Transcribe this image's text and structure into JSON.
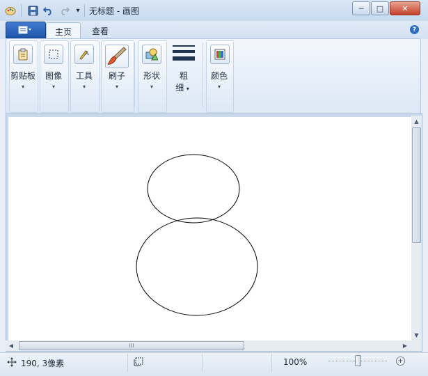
{
  "window": {
    "title": "无标题 - 画图",
    "minimize_glyph": "─",
    "maximize_glyph": "□",
    "close_glyph": "✕"
  },
  "quick_access": {
    "app_icon": "paint-app-icon",
    "save_icon": "save-icon",
    "undo_icon": "undo-icon",
    "redo_icon": "redo-icon",
    "customize_glyph": "▾"
  },
  "tabs": [
    {
      "label": "主页",
      "active": true
    },
    {
      "label": "查看",
      "active": false
    }
  ],
  "ribbon": {
    "groups": [
      {
        "label": "剪贴板",
        "icon": "clipboard-icon"
      },
      {
        "label": "图像",
        "icon": "select-icon"
      },
      {
        "label": "工具",
        "icon": "tools-icon"
      },
      {
        "label": "刷子",
        "icon": "brush-icon"
      },
      {
        "label": "形状",
        "icon": "shapes-icon"
      },
      {
        "label_line1": "粗",
        "label_line2": "细",
        "icon": "line-width-icon"
      },
      {
        "label": "颜色",
        "icon": "colors-icon"
      }
    ],
    "dropdown_glyph": "▾"
  },
  "canvas": {
    "shapes": [
      {
        "type": "ellipse",
        "name": "small-ellipse"
      },
      {
        "type": "ellipse",
        "name": "large-ellipse"
      }
    ]
  },
  "scrollbars": {
    "up_glyph": "▲",
    "down_glyph": "▼",
    "left_glyph": "◀",
    "right_glyph": "▶",
    "grip_glyph": "III"
  },
  "status": {
    "cursor_position": "190, 3像素",
    "zoom": "100%"
  },
  "colors": {
    "chrome": "#dce8f6",
    "accent": "#1e55a8",
    "close": "#c4402a"
  }
}
